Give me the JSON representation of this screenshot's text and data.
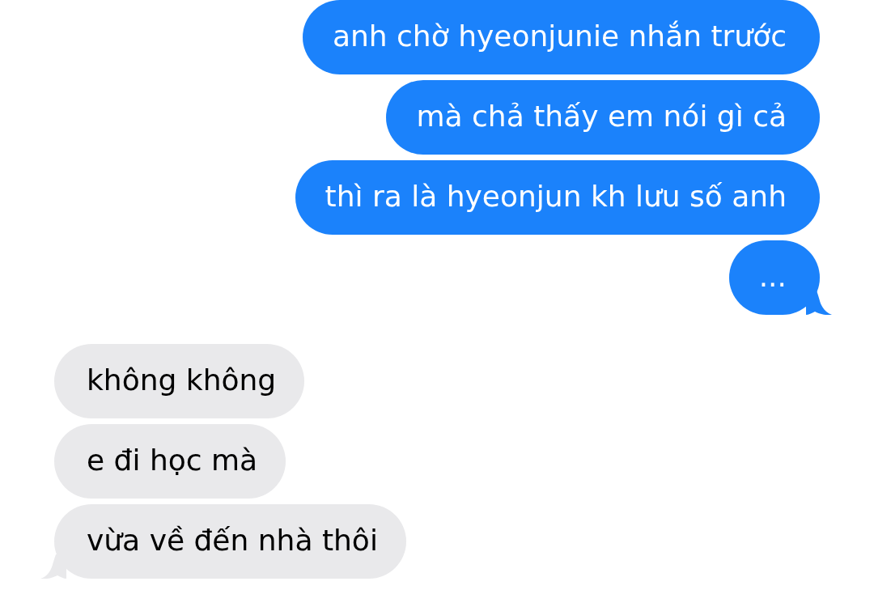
{
  "messages": [
    {
      "kind": "sent",
      "text": "anh chờ hyeonjunie nhắn trước"
    },
    {
      "kind": "sent",
      "text": "mà chả thấy em nói gì cả"
    },
    {
      "kind": "sent",
      "text": "thì ra là hyeonjun kh lưu số anh"
    },
    {
      "kind": "sent",
      "text": "..."
    },
    {
      "kind": "received",
      "text": "không không"
    },
    {
      "kind": "received",
      "text": "e đi học mà"
    },
    {
      "kind": "received",
      "text": "vừa về đến nhà thôi"
    }
  ]
}
